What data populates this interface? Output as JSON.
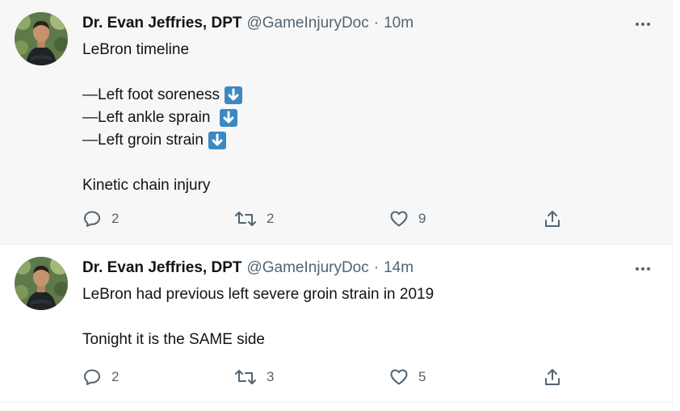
{
  "tweets": [
    {
      "author_name": "Dr. Evan Jeffries, DPT",
      "handle": "@GameInjuryDoc",
      "separator": "·",
      "time": "10m",
      "lines": [
        "LeBron timeline",
        "",
        "—Left foot soreness",
        "—Left ankle sprain ",
        "—Left groin strain",
        "",
        "Kinetic chain injury"
      ],
      "emoji_after_lines": [
        "down-arrow-emoji",
        "down-arrow-emoji",
        "down-arrow-emoji"
      ],
      "replies": "2",
      "retweets": "2",
      "likes": "9"
    },
    {
      "author_name": "Dr. Evan Jeffries, DPT",
      "handle": "@GameInjuryDoc",
      "separator": "·",
      "time": "14m",
      "lines": [
        "LeBron had previous left severe groin strain in 2019",
        "",
        "Tonight it is the SAME side"
      ],
      "replies": "2",
      "retweets": "3",
      "likes": "5"
    }
  ],
  "icons": {
    "more": "more-dots-icon",
    "reply": "reply-icon",
    "retweet": "retweet-icon",
    "like": "like-icon",
    "share": "share-icon"
  },
  "colors": {
    "text": "#0f1419",
    "muted": "#536471",
    "highlight_bg": "#f7f7f7",
    "emoji_blue": "#3b88c3"
  }
}
